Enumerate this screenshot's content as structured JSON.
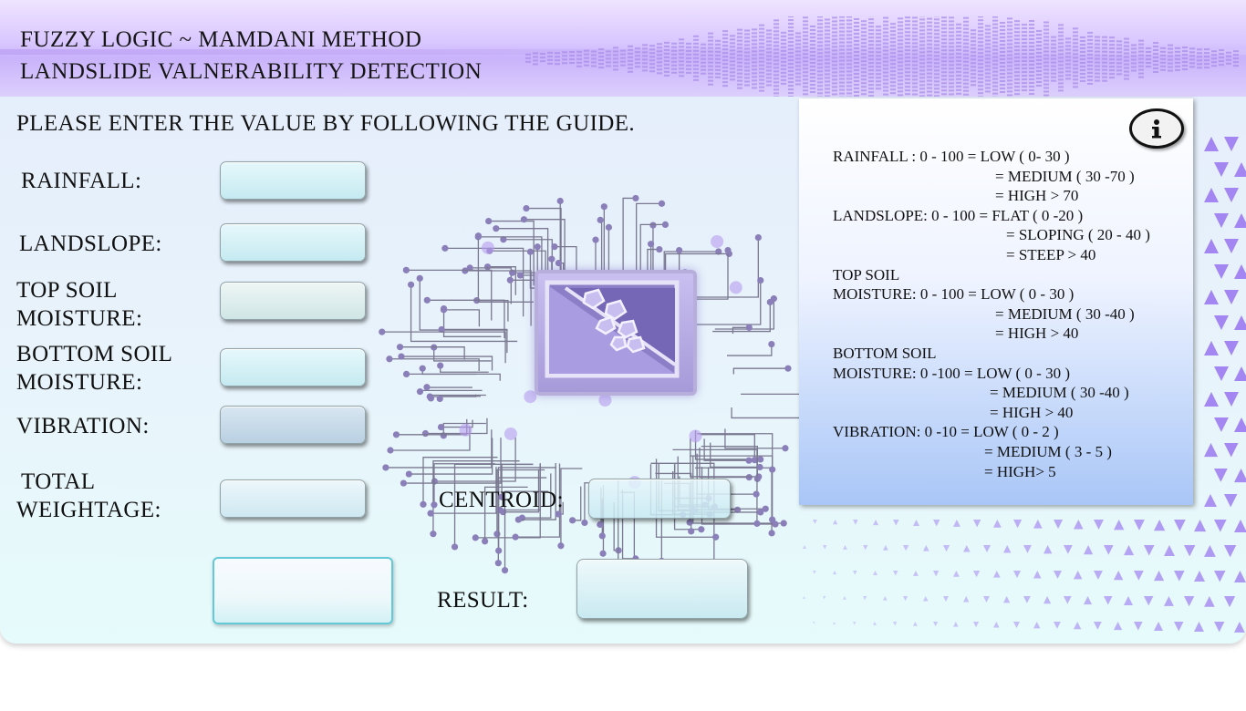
{
  "header": {
    "title_line1": "FUZZY LOGIC ~ MAMDANI METHOD",
    "title_line2": "LANDSLIDE VALNERABILITY DETECTION"
  },
  "instruction": "PLEASE ENTER THE VALUE BY FOLLOWING THE GUIDE.",
  "fields": {
    "rainfall": {
      "label": "RAINFALL:",
      "value": ""
    },
    "landslope": {
      "label": "LANDSLOPE:",
      "value": ""
    },
    "top_soil": {
      "label_line1": "TOP SOIL",
      "label_line2": "MOISTURE:",
      "value": ""
    },
    "bottom_soil": {
      "label_line1": "BOTTOM SOIL",
      "label_line2": "MOISTURE:",
      "value": ""
    },
    "vibration": {
      "label": "VIBRATION:",
      "value": ""
    },
    "total_weightage": {
      "label_line1": "TOTAL",
      "label_line2": "WEIGHTAGE:",
      "value": ""
    },
    "centroid": {
      "label": "CENTROID:",
      "value": ""
    },
    "result": {
      "label": "RESULT:",
      "value": ""
    }
  },
  "calculate_button": {
    "label": ""
  },
  "guide": {
    "info_icon": "info-icon",
    "lines": [
      "RAINFALL : 0 - 100 = LOW ( 0- 30 )",
      "= MEDIUM ( 30 -70 )",
      "= HIGH > 70",
      "LANDSLOPE: 0 - 100 = FLAT ( 0 -20 )",
      "= SLOPING ( 20 - 40 )",
      "= STEEP > 40",
      "TOP SOIL",
      "MOISTURE: 0 - 100 = LOW ( 0 - 30 )",
      "= MEDIUM ( 30 -40 )",
      "= HIGH > 40",
      "BOTTOM SOIL",
      "MOISTURE: 0 -100 = LOW ( 0 - 30 )",
      "= MEDIUM ( 30 -40 )",
      "= HIGH > 40",
      "VIBRATION: 0 -10 = LOW ( 0 - 2 )",
      "= MEDIUM ( 3 - 5 )",
      "= HIGH> 5"
    ]
  },
  "colors": {
    "accent_purple": "#b89af2",
    "field_cyan": "#c5eaf1",
    "button_border": "#63c9d6"
  }
}
